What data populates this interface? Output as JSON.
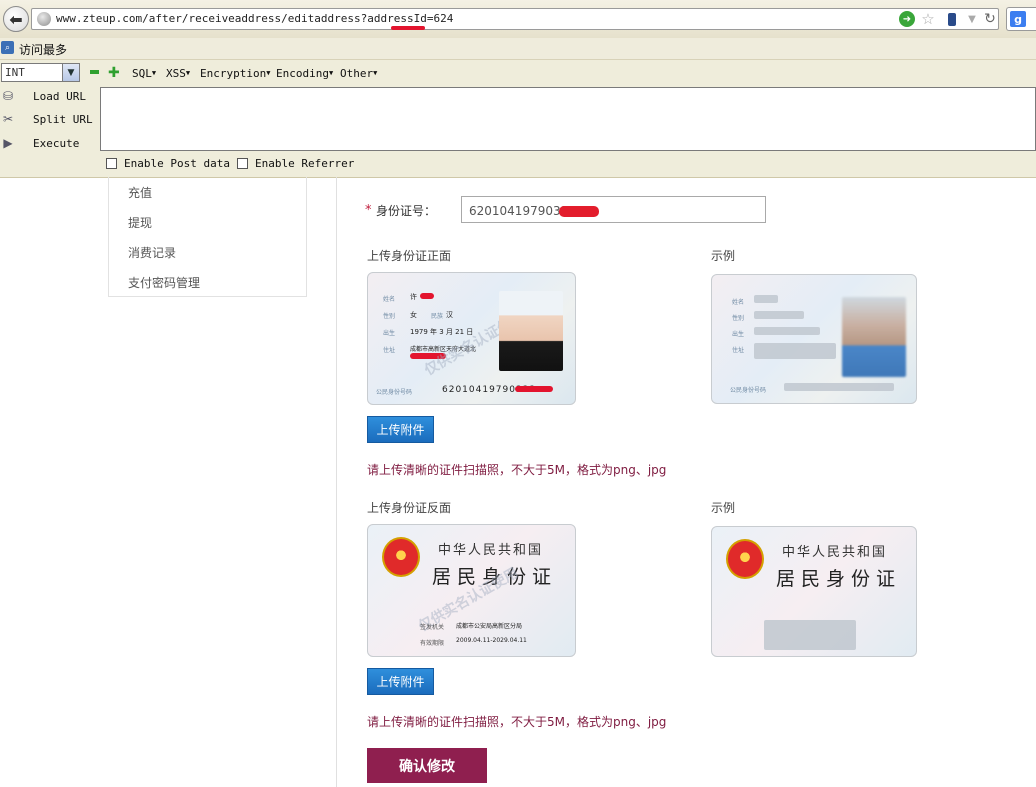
{
  "browser": {
    "url": "www.zteup.com/after/receiveaddress/editaddress?addressId=624",
    "bookmark_label": "访问最多"
  },
  "hackbar": {
    "select_value": "INT",
    "menus": [
      "SQL",
      "XSS",
      "Encryption",
      "Encoding",
      "Other"
    ],
    "actions": [
      "Load URL",
      "Split URL",
      "Execute"
    ],
    "checkboxes": [
      "Enable Post data",
      "Enable Referrer"
    ]
  },
  "sidebar": {
    "items": [
      "充值",
      "提现",
      "消费记录",
      "支付密码管理"
    ]
  },
  "form": {
    "id_label": "身份证号：",
    "id_value": "62010419790322",
    "front_label": "上传身份证正面",
    "back_label": "上传身份证反面",
    "example_label": "示例",
    "upload_label": "上传附件",
    "hint": "请上传清晰的证件扫描照，不大于5M，格式为png、jpg",
    "confirm_label": "确认修改"
  },
  "card_front": {
    "name_label": "姓名",
    "name_value": "许",
    "gender_label": "性别",
    "gender_value": "女",
    "ethnicity_label": "民族",
    "ethnicity_value": "汉",
    "birth_label": "出生",
    "birth_value": "1979 年 3 月 21 日",
    "address_label": "住址",
    "address_value": "成都市高新区天府大道北",
    "number_label": "公民身份号码",
    "number_value": "62010419790322",
    "watermark": "仅供实名认证使用",
    "example_name_label": "姓名",
    "example_gender_label": "性别",
    "example_birth_label": "出生",
    "example_address_label": "住址"
  },
  "card_back": {
    "title_line1": "中华人民共和国",
    "title_line2": "居民身份证",
    "authority_label": "签发机关",
    "authority_value": "成都市公安局高新区分局",
    "validity_label": "有效期限",
    "validity_value": "2009.04.11-2029.04.11",
    "watermark": "仅供实名认证使用"
  },
  "colors": {
    "accent": "#8f1f4f",
    "upload_button": "#1b6cbd",
    "hint_text": "#7f1b40",
    "required_star": "#c01d3c"
  }
}
